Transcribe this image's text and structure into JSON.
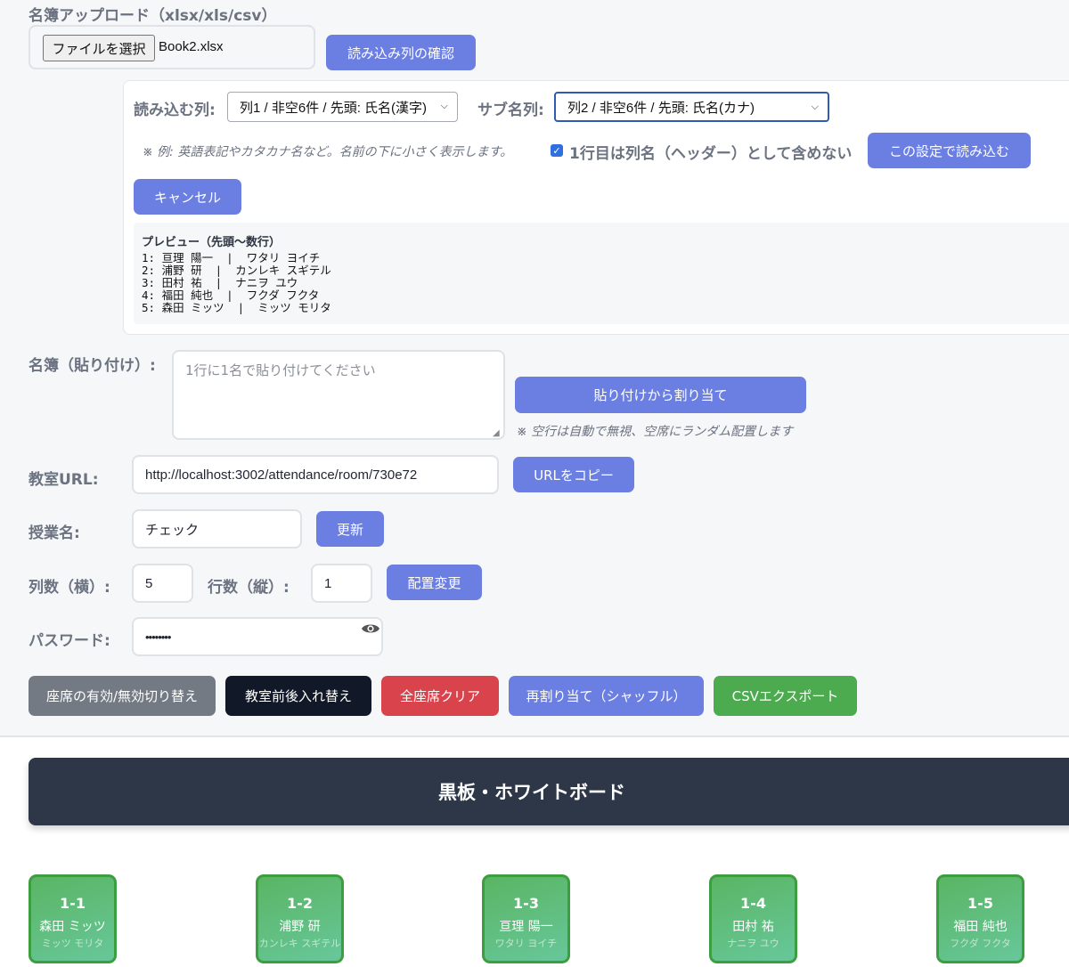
{
  "upload": {
    "title": "名簿アップロード（xlsx/xls/csv）",
    "file_button": "ファイルを選択",
    "file_name": "Book2.xlsx",
    "check_button": "読み込み列の確認"
  },
  "column_config": {
    "read_label": "読み込む列:",
    "read_value": "列1 / 非空6件 / 先頭: 氏名(漢字)",
    "sub_label": "サブ名列:",
    "sub_value": "列2 / 非空6件 / 先頭: 氏名(カナ)",
    "note": "※ 例: 英語表記やカタカナ名など。名前の下に小さく表示します。",
    "header_checkbox_label": "1行目は列名（ヘッダー）として含めない",
    "header_checked": true,
    "apply_button": "この設定で読み込む",
    "cancel_button": "キャンセル",
    "preview_title": "プレビュー（先頭〜数行）",
    "preview_lines": [
      "1: 亘理 陽一  |  ワタリ ヨイチ",
      "2: 浦野 研  |  カンレキ スギテル",
      "3: 田村 祐  |  ナニヲ ユウ",
      "4: 福田 純也  |  フクダ フクタ",
      "5: 森田 ミッツ  |  ミッツ モリタ"
    ]
  },
  "paste": {
    "label": "名簿（貼り付け）:",
    "placeholder": "1行に1名で貼り付けてください",
    "button": "貼り付けから割り当て",
    "note": "※ 空行は自動で無視、空席にランダム配置します"
  },
  "room_url": {
    "label": "教室URL:",
    "value": "http://localhost:3002/attendance/room/730e72",
    "copy_button": "URLをコピー"
  },
  "class_name": {
    "label": "授業名:",
    "value": "チェック",
    "update_button": "更新"
  },
  "layout": {
    "cols_label": "列数（横）:",
    "cols_value": "5",
    "rows_label": "行数（縦）:",
    "rows_value": "1",
    "apply_button": "配置変更"
  },
  "password": {
    "label": "パスワード:",
    "value": "••••••••",
    "toggle_icon": "eye-icon"
  },
  "actions": {
    "toggle_seats": "座席の有効/無効切り替え",
    "swap_front_back": "教室前後入れ替え",
    "clear_all": "全座席クリア",
    "shuffle": "再割り当て（シャッフル）",
    "export_csv": "CSVエクスポート"
  },
  "board": {
    "title": "黒板・ホワイトボード"
  },
  "seats": [
    {
      "id": "1-1",
      "name": "森田 ミッツ",
      "sub": "ミッツ モリタ"
    },
    {
      "id": "1-2",
      "name": "浦野 研",
      "sub": "カンレキ スギテル"
    },
    {
      "id": "1-3",
      "name": "亘理 陽一",
      "sub": "ワタリ ヨイチ"
    },
    {
      "id": "1-4",
      "name": "田村 祐",
      "sub": "ナニヲ ユウ"
    },
    {
      "id": "1-5",
      "name": "福田 純也",
      "sub": "フクダ フクタ"
    }
  ],
  "colors": {
    "primary": "#6b7fe3",
    "secondary": "#737a84",
    "dark": "#111827",
    "danger": "#d9434c",
    "success": "#4caa4f",
    "board": "#2d3748",
    "seat": "#5ab563"
  }
}
